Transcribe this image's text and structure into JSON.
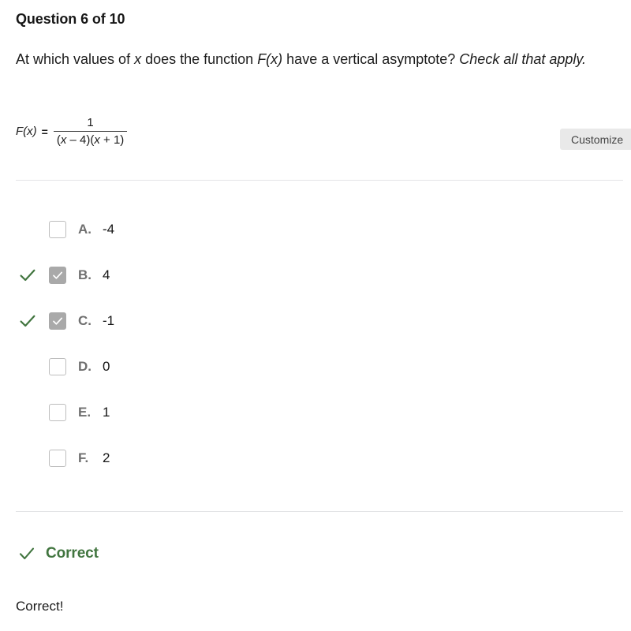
{
  "header": {
    "question_counter": "Question 6 of 10",
    "prompt_part1": "At which values of ",
    "prompt_var1": "x",
    "prompt_part2": " does the function ",
    "prompt_var2": "F(x)",
    "prompt_part3": " have a vertical asymptote? ",
    "prompt_italic": "Check all that apply."
  },
  "formula": {
    "lhs": "F(x)",
    "equals": "=",
    "numerator": "1",
    "denominator_open1": "(",
    "denominator_var1": "x",
    "denominator_mid1": " – 4)(",
    "denominator_var2": "x",
    "denominator_mid2": " + 1)"
  },
  "toolbar": {
    "customize_label": "Customize"
  },
  "options": [
    {
      "letter": "A.",
      "value": "-4",
      "checked": false,
      "correct": false
    },
    {
      "letter": "B.",
      "value": "4",
      "checked": true,
      "correct": true
    },
    {
      "letter": "C.",
      "value": "-1",
      "checked": true,
      "correct": true
    },
    {
      "letter": "D.",
      "value": "0",
      "checked": false,
      "correct": false
    },
    {
      "letter": "E.",
      "value": "1",
      "checked": false,
      "correct": false
    },
    {
      "letter": "F.",
      "value": "2",
      "checked": false,
      "correct": false
    }
  ],
  "result": {
    "status_label": "Correct",
    "detail_text": "Correct!",
    "status_color": "#41753f",
    "check_icon": "check-icon"
  },
  "colors": {
    "green": "#41753f",
    "checkbox_checked_fill": "#a9a9a9",
    "checkbox_border": "#bdbdbd",
    "divider": "#e3e4e6",
    "button_bg": "#e9e9e9",
    "text": "#1a1a1a",
    "letter_gray": "#6f6f6f"
  }
}
